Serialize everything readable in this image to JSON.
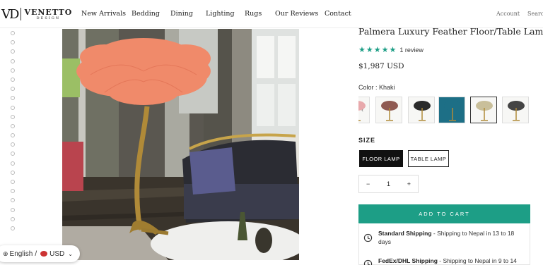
{
  "logo": {
    "mark": "VD",
    "name": "VENETTO",
    "sub": "DESIGN"
  },
  "nav": [
    "New Arrivals",
    "Bedding",
    "Dining",
    "Lighting",
    "Rugs",
    "Our Reviews",
    "Contact"
  ],
  "header_right": {
    "account": "Account",
    "search": "Search"
  },
  "product": {
    "title": "Palmera Luxury Feather Floor/Table Lamp",
    "stars": "★★★★★",
    "review_count": "1 review",
    "price": "$1,987 USD",
    "color_label": "Color : Khaki",
    "size_label": "SIZE",
    "sizes": [
      "FLOOR LAMP",
      "TABLE LAMP"
    ],
    "selected_size": "FLOOR LAMP",
    "quantity": "1",
    "qty_minus": "−",
    "qty_plus": "+",
    "add_to_cart": "ADD TO CART"
  },
  "swatches": [
    {
      "name": "pink",
      "color": "#e8a9ac"
    },
    {
      "name": "mauve",
      "color": "#8f5a52"
    },
    {
      "name": "black",
      "color": "#2a2a2a"
    },
    {
      "name": "teal",
      "color": "#1d6f86"
    },
    {
      "name": "khaki",
      "color": "#c9bf9a"
    },
    {
      "name": "charcoal",
      "color": "#444"
    }
  ],
  "shipping": {
    "standard_title": "Standard Shipping",
    "standard_text": " - Shipping to Nepal in 13 to 18 days",
    "express_title": "FedEx/DHL Shipping",
    "express_text": " - Shipping to Nepal in 9 to 14"
  },
  "language": {
    "lang": "English",
    "sep": "/",
    "currency": "USD"
  },
  "colors": {
    "accent": "#1d9e86",
    "feather": "#f08a6a"
  }
}
